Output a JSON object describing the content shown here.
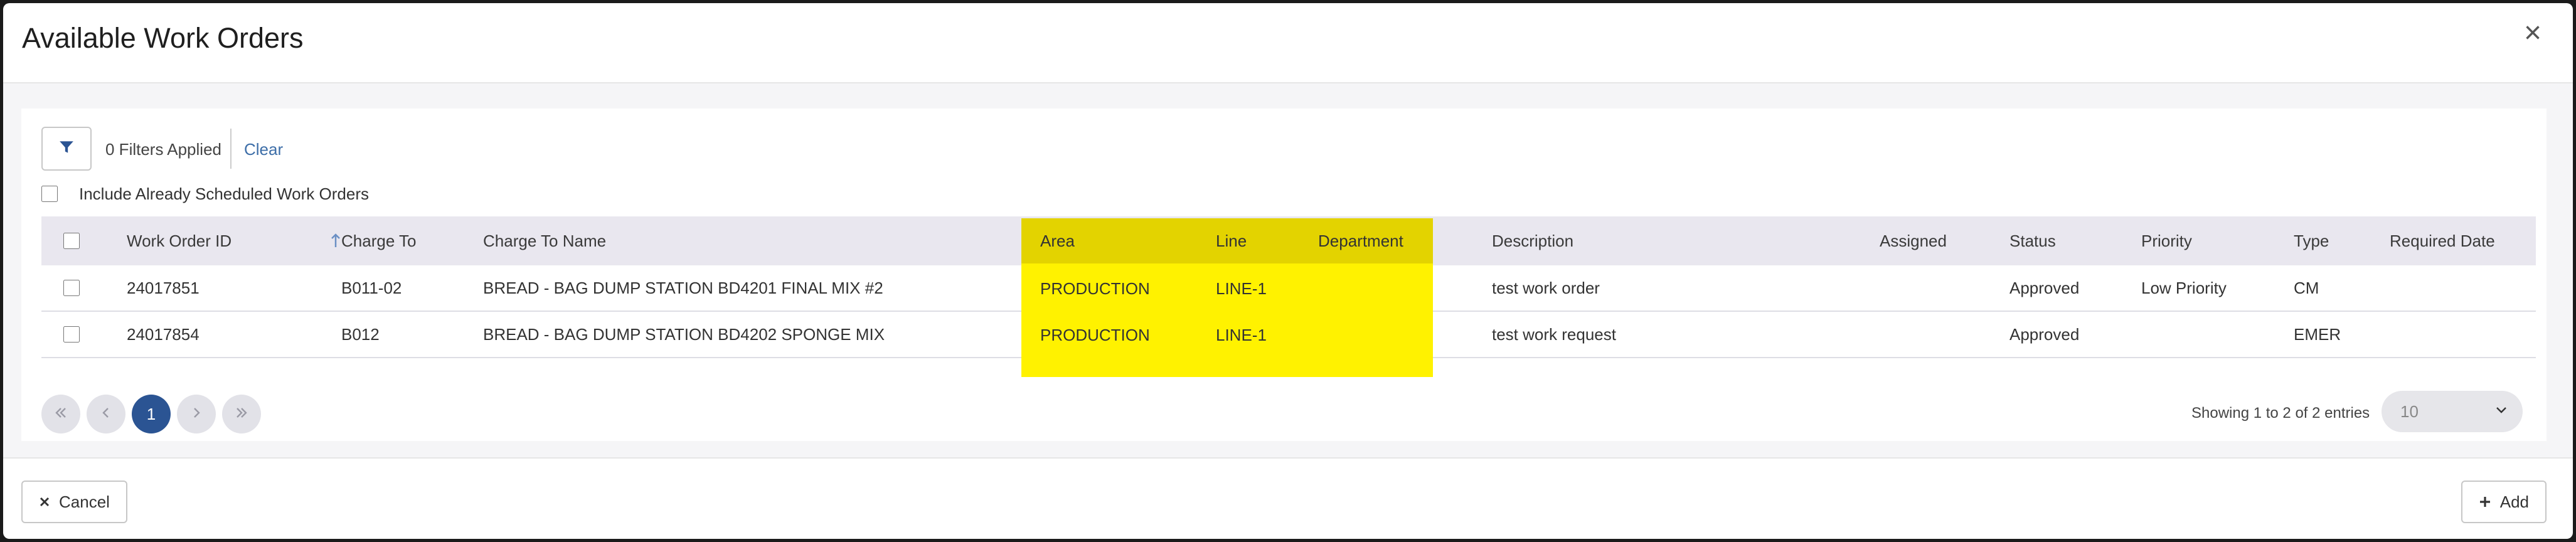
{
  "modal": {
    "title": "Available Work Orders",
    "close_label": "×"
  },
  "filters": {
    "applied_text": "0 Filters Applied",
    "clear_label": "Clear",
    "include_label": "Include Already Scheduled Work Orders"
  },
  "table": {
    "columns": {
      "work_order_id": "Work Order ID",
      "charge_to": "Charge To",
      "charge_to_name": "Charge To Name",
      "area": "Area",
      "line": "Line",
      "department": "Department",
      "description": "Description",
      "assigned": "Assigned",
      "status": "Status",
      "priority": "Priority",
      "type": "Type",
      "required_date": "Required Date"
    },
    "sorted_column": "Charge To",
    "rows": [
      {
        "work_order_id": "24017851",
        "charge_to": "B011-02",
        "charge_to_name": "BREAD - BAG DUMP STATION BD4201 FINAL MIX #2",
        "area": "PRODUCTION",
        "line": "LINE-1",
        "department": "",
        "description": "test work order",
        "assigned": "",
        "status": "Approved",
        "priority": "Low Priority",
        "type": "CM",
        "required_date": ""
      },
      {
        "work_order_id": "24017854",
        "charge_to": "B012",
        "charge_to_name": "BREAD - BAG DUMP STATION BD4202 SPONGE MIX",
        "area": "PRODUCTION",
        "line": "LINE-1",
        "department": "",
        "description": "test work request",
        "assigned": "",
        "status": "Approved",
        "priority": "",
        "type": "EMER",
        "required_date": ""
      }
    ]
  },
  "pagination": {
    "current_page": "1",
    "entries_text": "Showing 1 to 2 of 2 entries",
    "page_size": "10"
  },
  "footer": {
    "cancel_label": "Cancel",
    "add_label": "Add"
  },
  "colors": {
    "highlight": "#fff200",
    "primary": "#2b5493",
    "link": "#3d6ea8"
  }
}
